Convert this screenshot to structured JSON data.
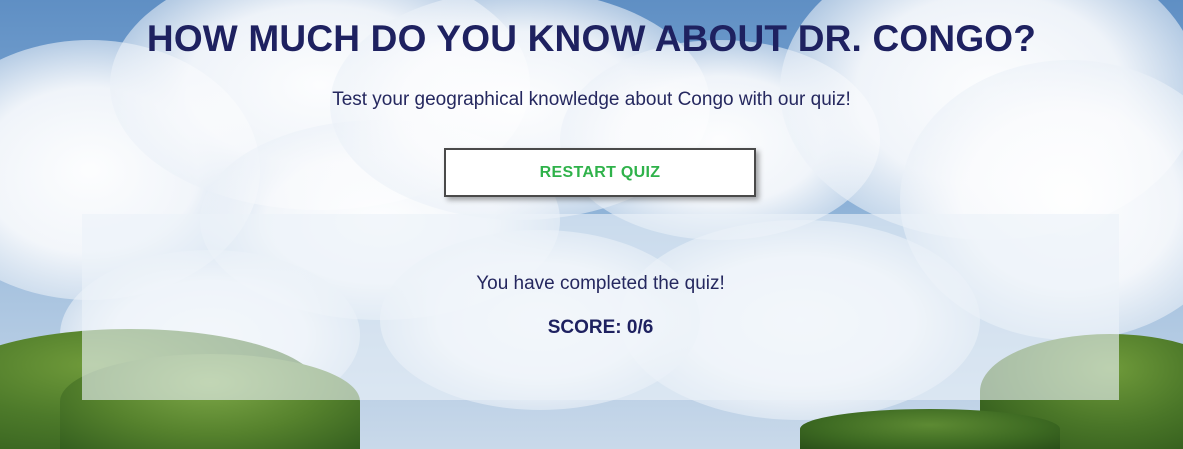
{
  "header": {
    "title": "HOW MUCH DO YOU KNOW ABOUT DR. CONGO?",
    "subtitle": "Test your geographical knowledge about Congo with our quiz!"
  },
  "controls": {
    "restart_label": "RESTART QUIZ"
  },
  "result": {
    "message": "You have completed the quiz!",
    "score_label": "SCORE:",
    "score_value": "0/6"
  },
  "colors": {
    "heading": "#1e2160",
    "button_text": "#2fb24a",
    "button_bg": "#ffffff",
    "panel_bg": "rgba(235,242,248,0.62)"
  }
}
